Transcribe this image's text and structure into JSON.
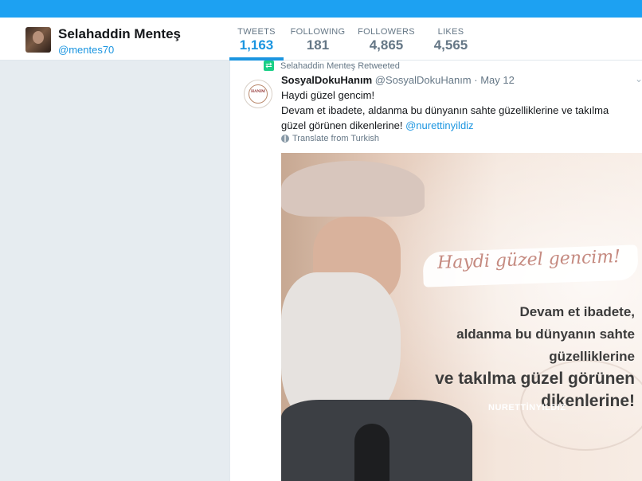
{
  "profile": {
    "name": "Selahaddin Menteş",
    "handle": "@mentes70"
  },
  "stats": [
    {
      "label": "TWEETS",
      "value": "1,163",
      "active": true
    },
    {
      "label": "FOLLOWING",
      "value": "181",
      "active": false
    },
    {
      "label": "FOLLOWERS",
      "value": "4,865",
      "active": false
    },
    {
      "label": "LIKES",
      "value": "4,565",
      "active": false
    }
  ],
  "tweet": {
    "retweet_context": "Selahaddin Menteş Retweeted",
    "author_name": "SosyalDokuHanım",
    "author_handle": "@SosyalDokuHanım",
    "separator": " · ",
    "date": "May 12",
    "avatar_text": "HANIM",
    "text_line1": "Haydi güzel gencim!",
    "text_line2": "Devam et ibadete, aldanma bu dünyanın sahte güzelliklerine ve takılma güzel görünen dikenlerine! ",
    "mention": "@nurettinyildiz",
    "translate_label": "Translate from Turkish",
    "image": {
      "title": "Haydi güzel gencim!",
      "line1": "Devam et ibadete,",
      "line2": "aldanma bu dünyanın sahte güzelliklerine",
      "line3": "ve takılma güzel görünen dikenlerine!",
      "brand": "NURETTİNYILDIZ"
    }
  },
  "icons": {
    "retweet": "retweet-icon",
    "globe": "globe-icon",
    "chevron": "chevron-down-icon"
  },
  "colors": {
    "brand_blue": "#1da1f2",
    "link_blue": "#1b95e0",
    "retweet_green": "#19cf86"
  }
}
